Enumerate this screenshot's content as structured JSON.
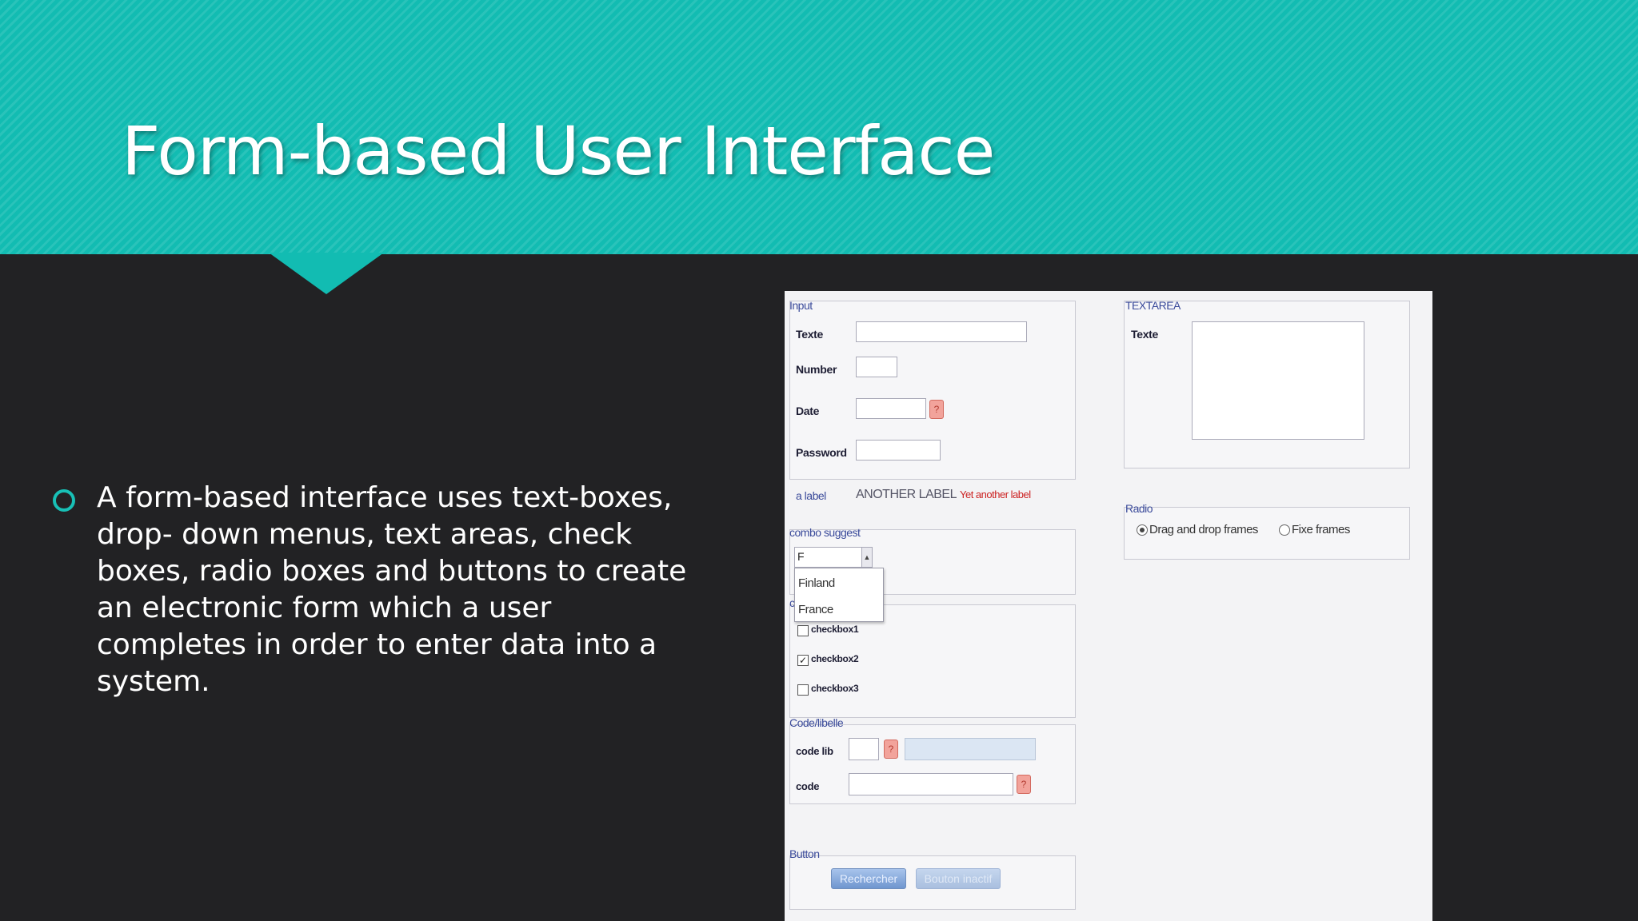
{
  "slide": {
    "title": "Form-based User Interface",
    "bullet": "A form-based interface uses text-boxes, drop- down menus, text areas, check boxes, radio boxes and buttons to create an electronic form which a user completes in order to enter data into a system."
  },
  "form": {
    "input": {
      "legend": "Input",
      "texte_label": "Texte",
      "number_label": "Number",
      "date_label": "Date",
      "password_label": "Password",
      "a_label": "a label",
      "another_label": "ANOTHER LABEL",
      "yet_another_label": "Yet another label"
    },
    "combo": {
      "legend": "combo suggest",
      "value": "F",
      "options": [
        "Finland",
        "France"
      ]
    },
    "checkboxes": {
      "legend": "cb",
      "items": [
        {
          "label": "checkbox1",
          "checked": false
        },
        {
          "label": "checkbox2",
          "checked": true
        },
        {
          "label": "checkbox3",
          "checked": false
        }
      ]
    },
    "codelabel": {
      "legend": "Code/libelle",
      "codelib_label": "code lib",
      "code_label": "code"
    },
    "buttons": {
      "legend": "Button",
      "search": "Rechercher",
      "disabled": "Bouton inactif"
    },
    "textarea": {
      "legend": "TEXTAREA",
      "texte_label": "Texte"
    },
    "radio": {
      "legend": "Radio",
      "options": [
        {
          "label": "Drag and drop frames",
          "selected": true
        },
        {
          "label": "Fixe frames",
          "selected": false
        }
      ]
    },
    "help_glyph": "?",
    "check_glyph": "✓",
    "dropdown_glyph": "▲"
  },
  "colors": {
    "header": "#12bcb2",
    "background": "#222224",
    "accent_label": "#cc2222"
  }
}
